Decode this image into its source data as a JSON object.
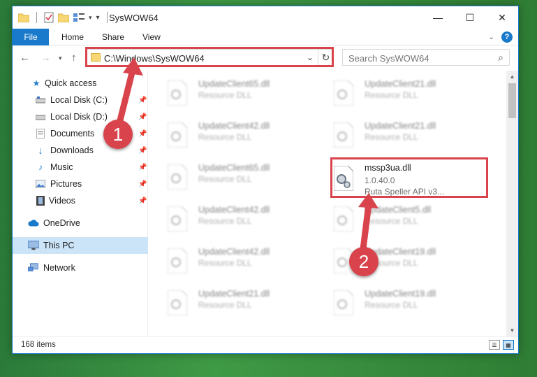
{
  "window": {
    "title": "SysWOW64",
    "controls": {
      "minimize": "—",
      "maximize": "☐",
      "close": "✕"
    }
  },
  "ribbon": {
    "tabs": [
      "File",
      "Home",
      "Share",
      "View"
    ]
  },
  "address": {
    "path": "C:\\Windows\\SysWOW64",
    "search_placeholder": "Search SysWOW64"
  },
  "sidebar": {
    "items": [
      {
        "label": "Quick access",
        "icon": "star-icon"
      },
      {
        "label": "Local Disk (C:)",
        "icon": "drive-icon",
        "pinned": true
      },
      {
        "label": "Local Disk (D:)",
        "icon": "drive-icon",
        "pinned": true
      },
      {
        "label": "Documents",
        "icon": "documents-icon",
        "pinned": true
      },
      {
        "label": "Downloads",
        "icon": "download-icon",
        "pinned": true
      },
      {
        "label": "Music",
        "icon": "music-icon",
        "pinned": true
      },
      {
        "label": "Pictures",
        "icon": "pictures-icon",
        "pinned": true
      },
      {
        "label": "Videos",
        "icon": "videos-icon",
        "pinned": true
      },
      {
        "label": "OneDrive",
        "icon": "cloud-icon"
      },
      {
        "label": "This PC",
        "icon": "computer-icon",
        "selected": true
      },
      {
        "label": "Network",
        "icon": "network-icon"
      }
    ]
  },
  "files": {
    "left": [
      {
        "name": "UpdateClient65.dll",
        "desc": "Resource DLL"
      },
      {
        "name": "UpdateClient42.dll",
        "desc": "Resource DLL"
      },
      {
        "name": "UpdateClient65.dll",
        "desc": "Resource DLL"
      },
      {
        "name": "UpdateClient42.dll",
        "desc": "Resource DLL"
      },
      {
        "name": "UpdateClient42.dll",
        "desc": "Resource DLL"
      },
      {
        "name": "UpdateClient21.dll",
        "desc": "Resource DLL"
      }
    ],
    "right": [
      {
        "name": "UpdateClient21.dll",
        "desc": "Resource DLL"
      },
      {
        "name": "UpdateClient21.dll",
        "desc": "Resource DLL"
      },
      {
        "name": "mssp3ua.dll",
        "version": "1.0.40.0",
        "desc": "Ruta Speller API v3...",
        "highlighted": true
      },
      {
        "name": "UpdateClient5.dll",
        "desc": "Resource DLL"
      },
      {
        "name": "UpdateClient19.dll",
        "desc": "Resource DLL"
      },
      {
        "name": "UpdateClient19.dll",
        "desc": "Resource DLL"
      }
    ]
  },
  "status": {
    "item_count": "168 items"
  },
  "annotations": {
    "step1": "1",
    "step2": "2",
    "color": "#d9434b"
  },
  "colors": {
    "accent": "#1979ca",
    "highlight": "#d9434b",
    "selected_bg": "#cce4f7"
  }
}
